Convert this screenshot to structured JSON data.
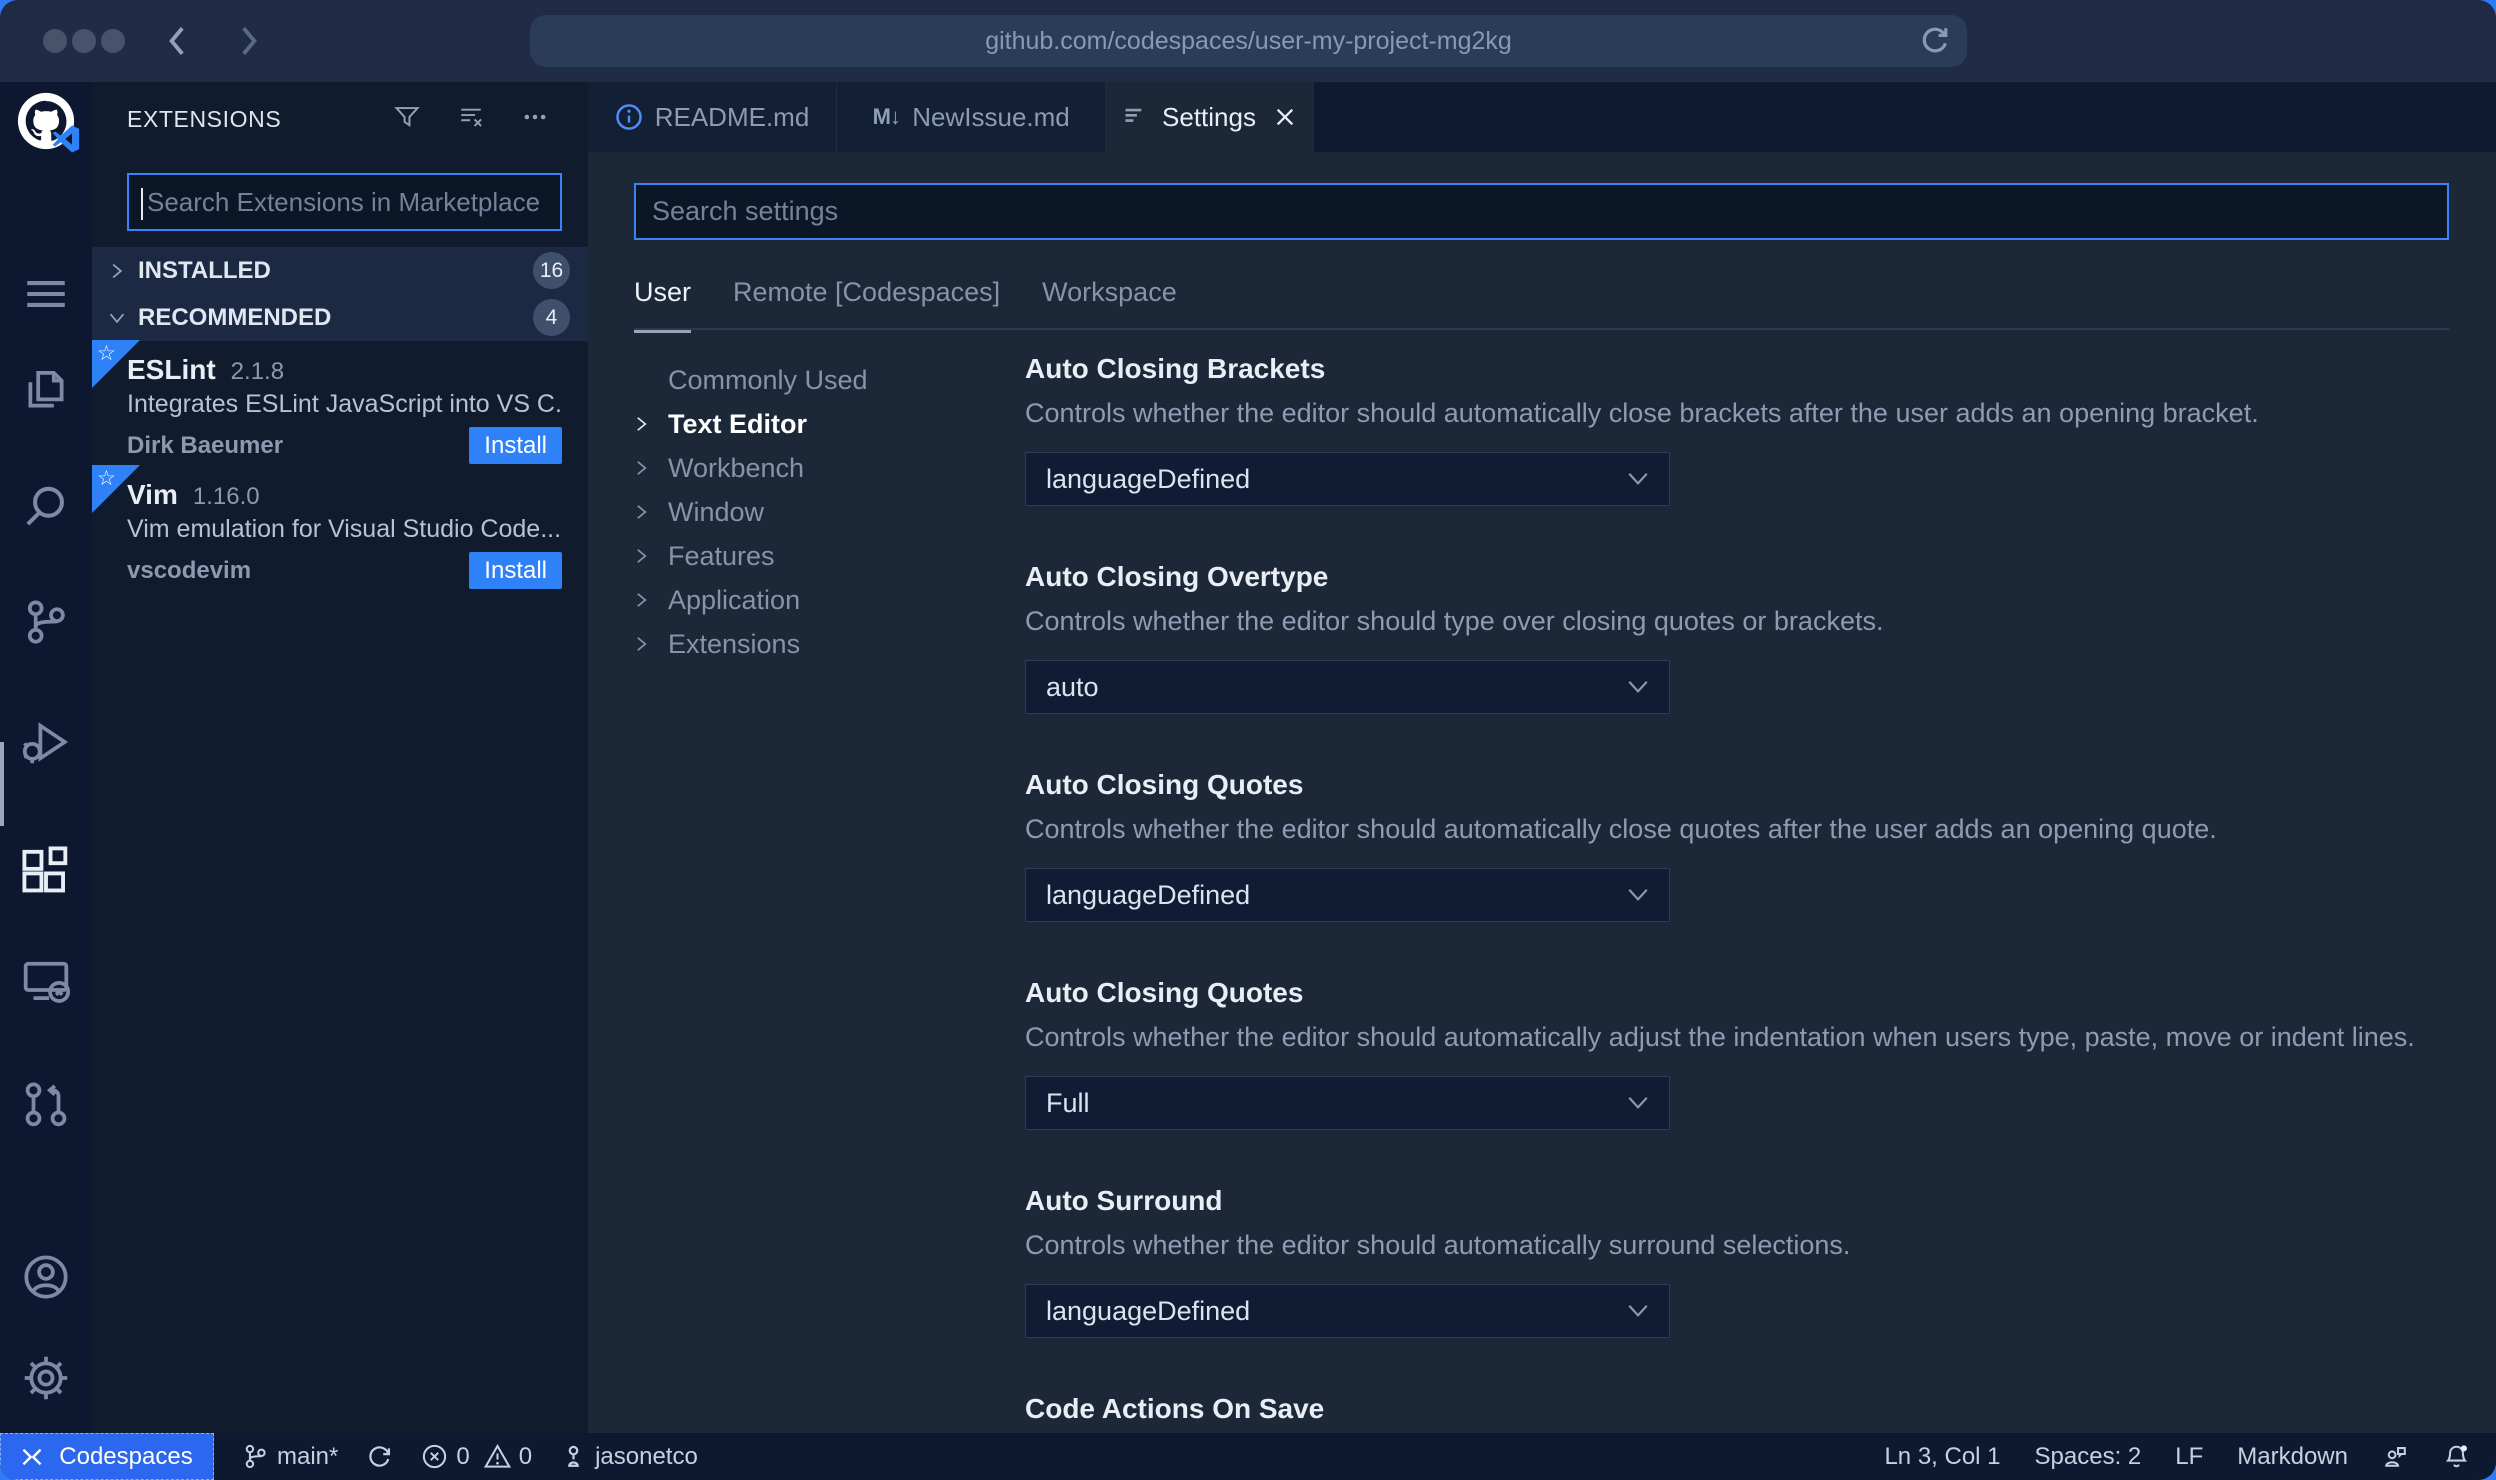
{
  "colors": {
    "accent_blue": "#2f81f7",
    "focus_border": "#3b82f6",
    "codespaces_blue": "#2b67ef",
    "editor_bg": "#1c2838",
    "sidebar_bg": "#101b2e"
  },
  "browser": {
    "url": "github.com/codespaces/user-my-project-mg2kg"
  },
  "activity_bar": {
    "icons": [
      "github-codespaces-logo",
      "menu-icon",
      "explorer-icon",
      "search-icon",
      "source-control-icon",
      "run-debug-icon",
      "extensions-icon",
      "remote-explorer-icon",
      "pull-request-icon",
      "account-icon",
      "settings-gear-icon"
    ],
    "active": "extensions-icon"
  },
  "sidebar": {
    "title": "EXTENSIONS",
    "tools": [
      "filter-icon",
      "clear-extension-search-icon",
      "more-actions-icon"
    ],
    "search_placeholder": "Search Extensions in Marketplace",
    "sections": [
      {
        "label": "INSTALLED",
        "count": "16",
        "state": "collapsed"
      },
      {
        "label": "RECOMMENDED",
        "count": "4",
        "state": "expanded"
      }
    ],
    "extensions": [
      {
        "name": "ESLint",
        "version": "2.1.8",
        "description": "Integrates ESLint JavaScript into VS C...",
        "publisher": "Dirk Baeumer",
        "action": "Install"
      },
      {
        "name": "Vim",
        "version": "1.16.0",
        "description": "Vim emulation for Visual Studio Code...",
        "publisher": "vscodevim",
        "action": "Install"
      }
    ]
  },
  "tabs": [
    {
      "label": "README.md",
      "icon": "info-icon"
    },
    {
      "label": "NewIssue.md",
      "icon": "markdown-icon",
      "icon_text": "M↓"
    },
    {
      "label": "Settings",
      "icon": "settings-editor-icon",
      "active": true
    }
  ],
  "settings": {
    "search_placeholder": "Search settings",
    "scopes": [
      "User",
      "Remote [Codespaces]",
      "Workspace"
    ],
    "active_scope": "User",
    "toc": [
      "Commonly Used",
      "Text Editor",
      "Workbench",
      "Window",
      "Features",
      "Application",
      "Extensions"
    ],
    "active_toc": "Text Editor",
    "items": [
      {
        "title": "Auto Closing Brackets",
        "description": "Controls whether the editor should automatically close brackets after the user adds an opening bracket.",
        "value": "languageDefined"
      },
      {
        "title": "Auto Closing Overtype",
        "description": "Controls whether the editor should type over closing quotes or brackets.",
        "value": "auto"
      },
      {
        "title": "Auto Closing Quotes",
        "description": "Controls whether the editor should automatically close quotes after the user adds an opening quote.",
        "value": "languageDefined"
      },
      {
        "title": "Auto Closing Quotes",
        "description": "Controls whether the editor should automatically adjust the indentation when users type, paste, move or indent lines.",
        "value": "Full"
      },
      {
        "title": "Auto Surround",
        "description": "Controls whether the editor should automatically surround selections.",
        "value": "languageDefined"
      },
      {
        "title": "Code Actions On Save"
      }
    ]
  },
  "status_bar": {
    "remote": "Codespaces",
    "branch": "main*",
    "errors": "0",
    "warnings": "0",
    "user": "jasonetco",
    "cursor": "Ln 3, Col 1",
    "indent": "Spaces: 2",
    "eol": "LF",
    "language": "Markdown"
  }
}
